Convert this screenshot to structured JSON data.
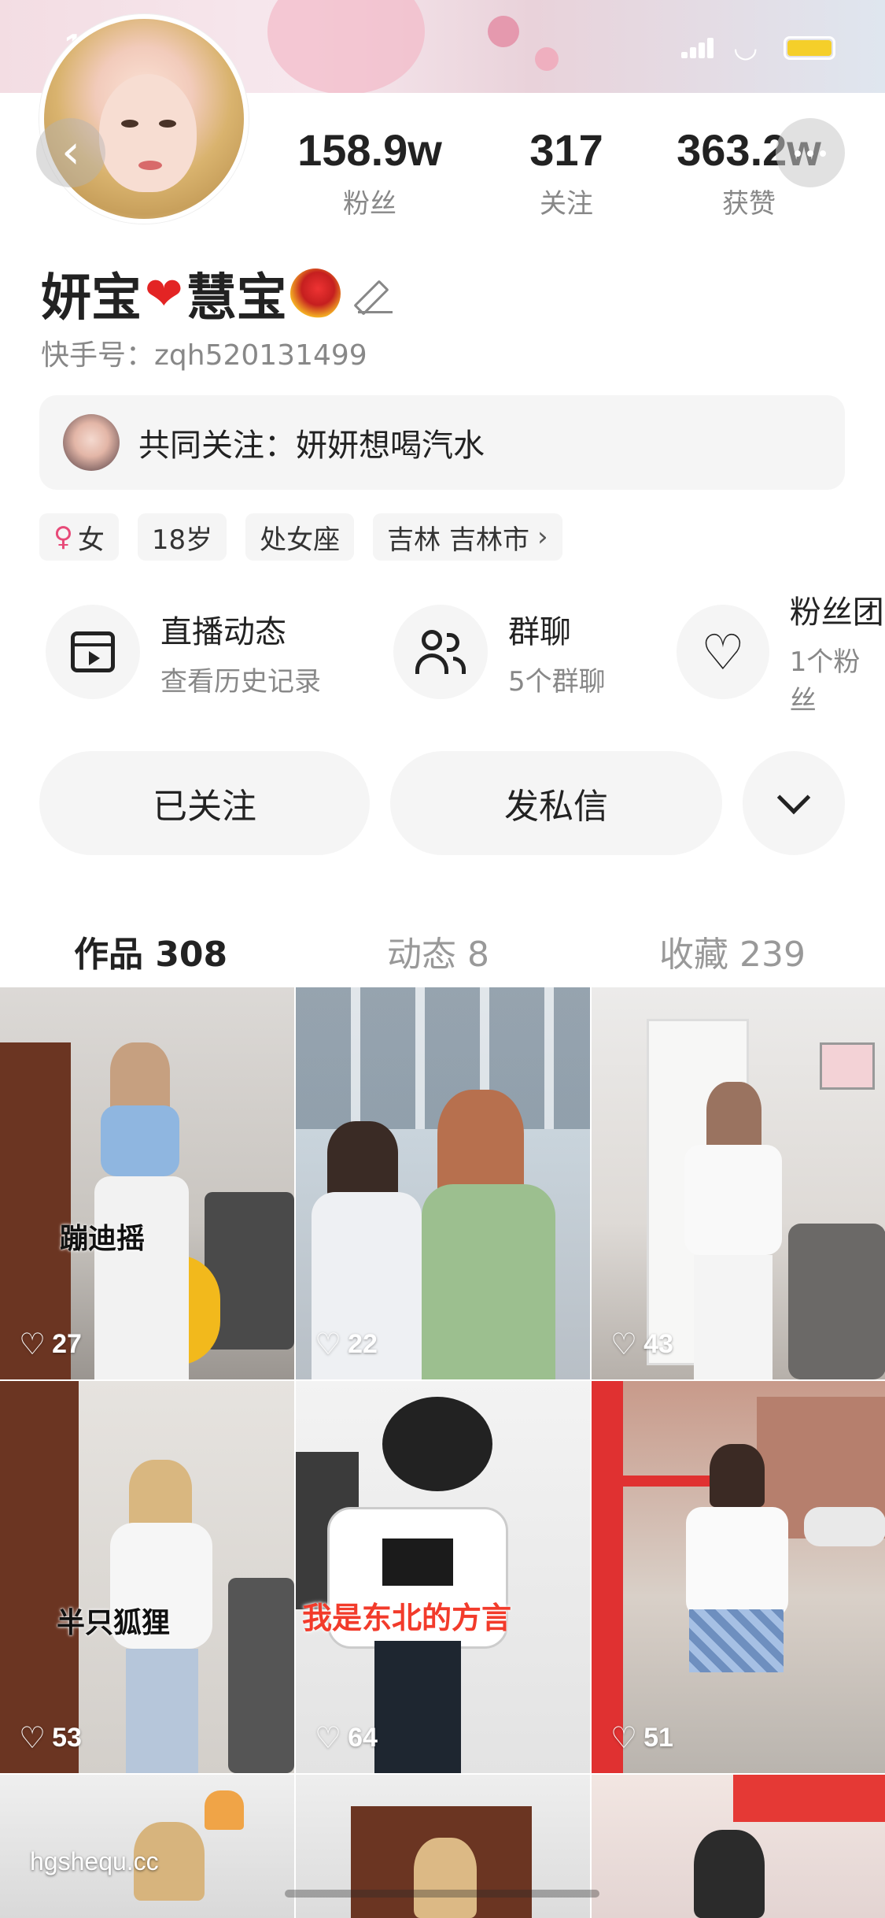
{
  "status_bar": {
    "time": "11:24"
  },
  "profile": {
    "name_part1": "妍宝",
    "name_part2": "慧宝",
    "kuaishou_id_label": "快手号：zqh520131499",
    "stats": [
      {
        "value": "158.9w",
        "label": "粉丝"
      },
      {
        "value": "317",
        "label": "关注"
      },
      {
        "value": "363.2w",
        "label": "获赞"
      }
    ],
    "mutual_follow": "共同关注：妍妍想喝汽水",
    "tags": {
      "gender": "女",
      "age": "18岁",
      "zodiac": "处女座",
      "location": "吉林 吉林市"
    }
  },
  "features": [
    {
      "title": "直播动态",
      "subtitle": "查看历史记录",
      "icon": "calendar-play-icon"
    },
    {
      "title": "群聊",
      "subtitle": "5个群聊",
      "icon": "people-icon"
    },
    {
      "title": "粉丝团",
      "subtitle": "1个粉丝",
      "icon": "heart-outline-icon"
    }
  ],
  "actions": {
    "follow": "已关注",
    "message": "发私信",
    "more": "chevron-down-icon"
  },
  "tabs": [
    {
      "label": "作品 308",
      "active": true
    },
    {
      "label": "动态 8",
      "active": false
    },
    {
      "label": "收藏 239",
      "active": false
    }
  ],
  "videos": [
    {
      "likes": "27",
      "caption": "蹦迪摇"
    },
    {
      "likes": "22",
      "caption": ""
    },
    {
      "likes": "43",
      "caption": ""
    },
    {
      "likes": "53",
      "caption": "半只狐狸"
    },
    {
      "likes": "64",
      "caption": "我是东北的方言"
    },
    {
      "likes": "51",
      "caption": ""
    }
  ],
  "watermark": "hgshequ.cc",
  "colors": {
    "accent_battery": "#f5cf2a",
    "heart": "#e32424",
    "female": "#e74a78"
  }
}
